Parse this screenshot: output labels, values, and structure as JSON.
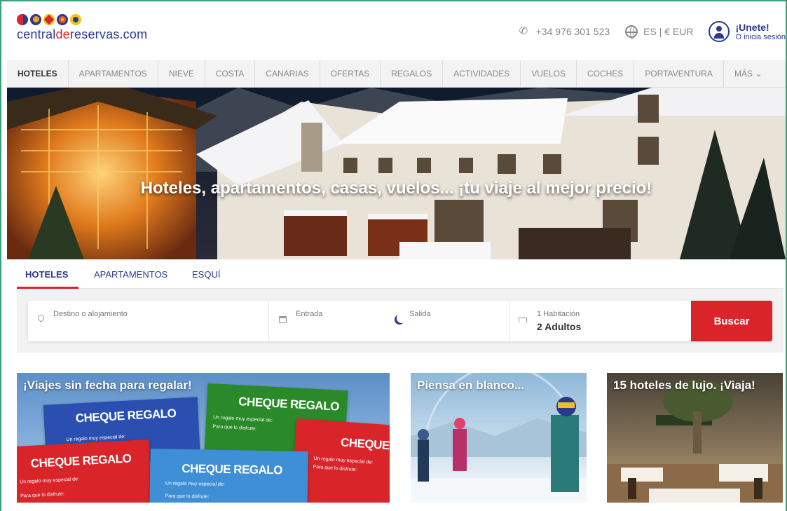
{
  "brand": {
    "part1": "central",
    "part2": "de",
    "part3": "reservas.com"
  },
  "header": {
    "phone": "+34 976 301 523",
    "locale": "ES | € EUR",
    "join_title": "¡Unete!",
    "join_sub": "O inicia sesión"
  },
  "nav": {
    "items": [
      "HOTELES",
      "APARTAMENTOS",
      "NIEVE",
      "COSTA",
      "CANARIAS",
      "OFERTAS",
      "REGALOS",
      "ACTIVIDADES",
      "VUELOS",
      "COCHES",
      "PORTAVENTURA",
      "MÁS"
    ],
    "active": "HOTELES"
  },
  "hero": {
    "title": "Hoteles, apartamentos, casas, vuelos... ¡tu viaje al mejor precio!"
  },
  "search": {
    "tabs": [
      "HOTELES",
      "APARTAMENTOS",
      "ESQUÍ"
    ],
    "destination_placeholder": "Destino o alojamiento",
    "checkin_label": "Entrada",
    "checkout_label": "Salida",
    "rooms_label": "1 Habitación",
    "guests_value": "2 Adultos",
    "submit_label": "Buscar"
  },
  "promos": [
    {
      "title": "¡Viajes sin fecha para regalar!"
    },
    {
      "title": "Piensa en blanco..."
    },
    {
      "title": "15 hoteles de lujo. ¡Viaja!"
    }
  ],
  "gift_cards": {
    "title": "CHEQUE REGALO",
    "title_short": "CHEQUE",
    "line1": "Un regalo muy especial de:",
    "line2": "Para que lo disfrute:"
  },
  "colors": {
    "brand_blue": "#2b3a8f",
    "brand_red": "#d9252a",
    "frame_green": "#3aa07a"
  }
}
